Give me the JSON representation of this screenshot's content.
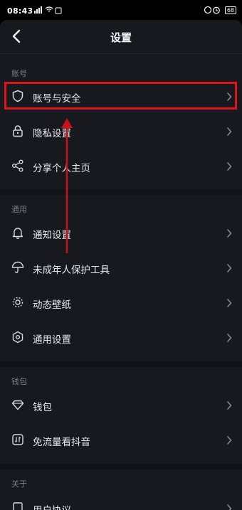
{
  "status": {
    "time": "08:43",
    "signal": "ᯤᯤ",
    "battery": "68"
  },
  "header": {
    "title": "设置"
  },
  "sections": {
    "account": {
      "label": "账号",
      "items": [
        "账号与安全",
        "隐私设置",
        "分享个人主页"
      ]
    },
    "general": {
      "label": "通用",
      "items": [
        "通知设置",
        "未成年人保护工具",
        "动态壁纸",
        "通用设置"
      ]
    },
    "wallet": {
      "label": "钱包",
      "items": [
        "钱包",
        "免流量看抖音"
      ]
    },
    "about": {
      "label": "关于",
      "items": [
        "用户协议"
      ]
    }
  },
  "colors": {
    "background": "#17191f",
    "highlight": "#e0141a"
  }
}
